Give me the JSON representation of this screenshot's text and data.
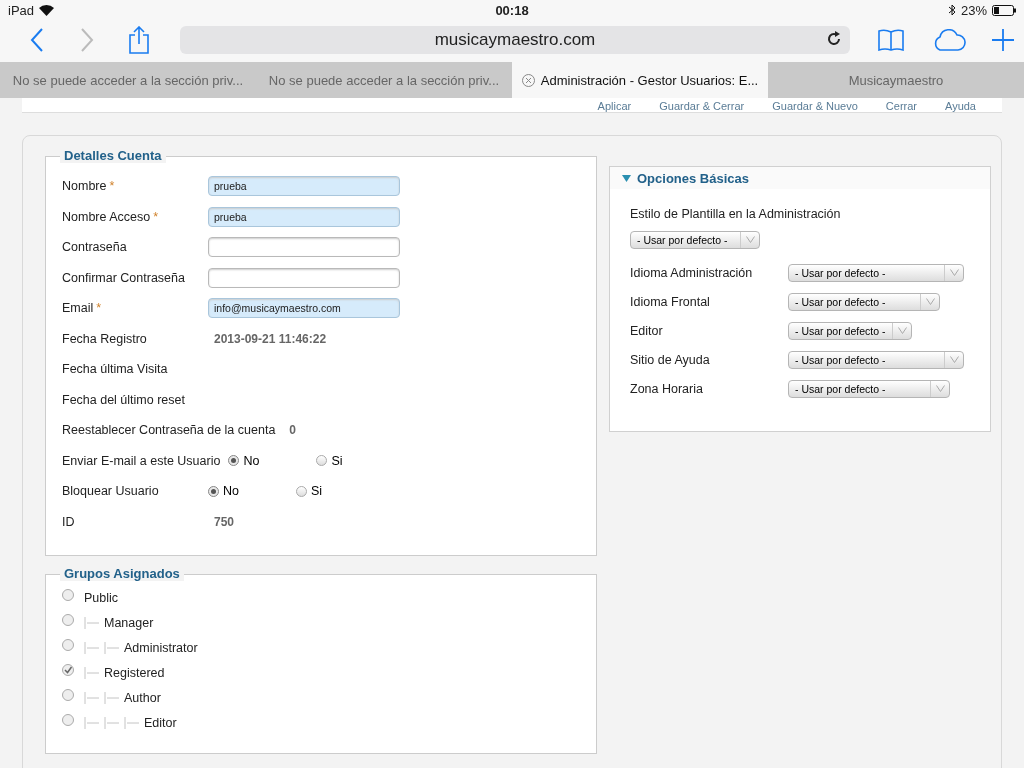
{
  "status_bar": {
    "device": "iPad",
    "time": "00:18",
    "battery": "23%"
  },
  "browser": {
    "url": "musicaymaestro.com",
    "tabs": [
      {
        "label": "No se puede acceder a la sección priv...",
        "selected": false,
        "closable": false
      },
      {
        "label": "No se puede acceder a la sección priv...",
        "selected": false,
        "closable": false
      },
      {
        "label": "Administración - Gestor Usuarios: E...",
        "selected": true,
        "closable": true
      },
      {
        "label": "Musicaymaestro",
        "selected": false,
        "closable": false
      }
    ]
  },
  "toolbar": [
    "Aplicar",
    "Guardar & Cerrar",
    "Guardar & Nuevo",
    "Cerrar",
    "Ayuda"
  ],
  "account": {
    "title": "Detalles Cuenta",
    "fields": [
      {
        "kind": "input",
        "label": "Nombre",
        "required_mark": "*",
        "value": "prueba",
        "filled": true
      },
      {
        "kind": "input",
        "label": "Nombre Acceso",
        "required_mark": "*",
        "value": "prueba",
        "filled": true
      },
      {
        "kind": "input",
        "label": "Contraseña",
        "filled": false
      },
      {
        "kind": "input",
        "label": "Confirmar Contraseña",
        "filled": false
      },
      {
        "kind": "input",
        "label": "Email",
        "required_mark": "*",
        "value": "info@musicaymaestro.com",
        "filled": true
      },
      {
        "kind": "text",
        "label": "Fecha Registro",
        "value": "2013-09-21 11:46:22"
      },
      {
        "kind": "text",
        "label": "Fecha última Visita"
      },
      {
        "kind": "text",
        "label": "Fecha del último reset"
      },
      {
        "kind": "text",
        "label": "Reestablecer Contraseña de la cuenta",
        "value": "0",
        "inline": true
      },
      {
        "kind": "radio",
        "label": "Enviar E-mail a este Usuario",
        "inline": true,
        "options": [
          {
            "label": "No",
            "selected": true
          },
          {
            "label": "Si",
            "selected": false
          }
        ]
      },
      {
        "kind": "radio",
        "label": "Bloquear Usuario",
        "options": [
          {
            "label": "No",
            "selected": true
          },
          {
            "label": "Si",
            "selected": false
          }
        ]
      },
      {
        "kind": "text",
        "label": "ID",
        "value": "750"
      }
    ]
  },
  "groups": {
    "title": "Grupos Asignados",
    "items": [
      {
        "label": "Public",
        "checked": false,
        "children": [
          {
            "label": "Manager",
            "checked": false,
            "children": [
              {
                "label": "Administrator",
                "checked": false
              }
            ]
          },
          {
            "label": "Registered",
            "checked": true,
            "children": [
              {
                "label": "Author",
                "checked": false,
                "children": [
                  {
                    "label": "Editor",
                    "checked": false
                  }
                ]
              }
            ]
          }
        ]
      }
    ]
  },
  "options": {
    "title": "Opciones Básicas",
    "expanded": true,
    "rows": [
      {
        "kind": "stacked",
        "label": "Estilo de Plantilla en la Administración",
        "value": "- Usar por defecto -"
      },
      {
        "kind": "inline",
        "label": "Idioma Administración",
        "value": "- Usar por defecto -"
      },
      {
        "kind": "inline",
        "label": "Idioma Frontal",
        "value": "- Usar por defecto -"
      },
      {
        "kind": "inline",
        "label": "Editor",
        "value": "- Usar por defecto -"
      },
      {
        "kind": "inline",
        "label": "Sitio de Ayuda",
        "value": "- Usar por defecto -"
      },
      {
        "kind": "inline",
        "label": "Zona Horaria",
        "value": "- Usar por defecto -"
      }
    ]
  }
}
